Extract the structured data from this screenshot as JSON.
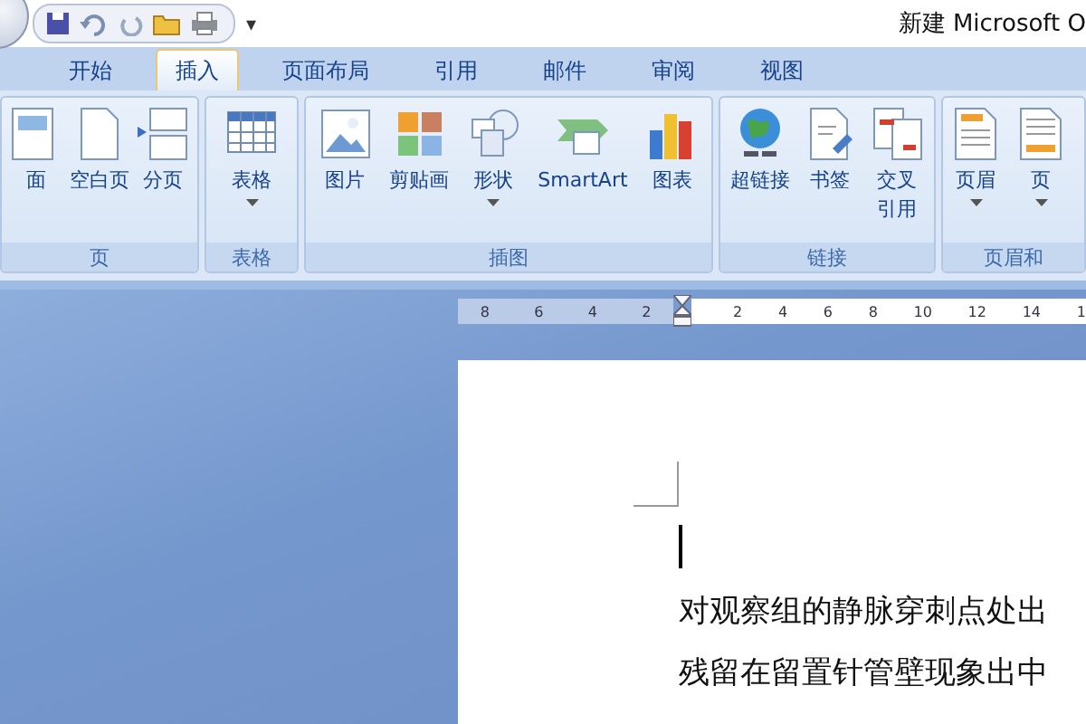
{
  "window": {
    "title": "新建 Microsoft O"
  },
  "quick_access": {
    "menu_glyph": "▾"
  },
  "tabs": [
    {
      "label": "开始",
      "selected": false
    },
    {
      "label": "插入",
      "selected": true
    },
    {
      "label": "页面布局",
      "selected": false
    },
    {
      "label": "引用",
      "selected": false
    },
    {
      "label": "邮件",
      "selected": false
    },
    {
      "label": "审阅",
      "selected": false
    },
    {
      "label": "视图",
      "selected": false
    }
  ],
  "ribbon_groups": [
    {
      "label": "页",
      "buttons": [
        {
          "label": "面",
          "dropdown": false
        },
        {
          "label": "空白页",
          "dropdown": false
        },
        {
          "label": "分页",
          "dropdown": false
        }
      ]
    },
    {
      "label": "表格",
      "buttons": [
        {
          "label": "表格",
          "dropdown": true
        }
      ]
    },
    {
      "label": "插图",
      "buttons": [
        {
          "label": "图片",
          "dropdown": false
        },
        {
          "label": "剪贴画",
          "dropdown": false
        },
        {
          "label": "形状",
          "dropdown": true
        },
        {
          "label": "SmartArt",
          "dropdown": false
        },
        {
          "label": "图表",
          "dropdown": false
        }
      ]
    },
    {
      "label": "链接",
      "buttons": [
        {
          "label": "超链接",
          "dropdown": false
        },
        {
          "label": "书签",
          "dropdown": false
        },
        {
          "label": "交叉引用",
          "dropdown": false
        }
      ]
    },
    {
      "label": "页眉和",
      "buttons": [
        {
          "label": "页眉",
          "dropdown": true
        },
        {
          "label": "页",
          "dropdown": true
        }
      ]
    }
  ],
  "ruler": {
    "left_labels": [
      "8",
      "6",
      "4",
      "2"
    ],
    "right_labels": [
      "2",
      "4",
      "6",
      "8",
      "10",
      "12",
      "14",
      "1"
    ]
  },
  "document": {
    "lines": [
      "对观察组的静脉穿刺点处出",
      "残留在留置针管壁现象出中"
    ]
  }
}
